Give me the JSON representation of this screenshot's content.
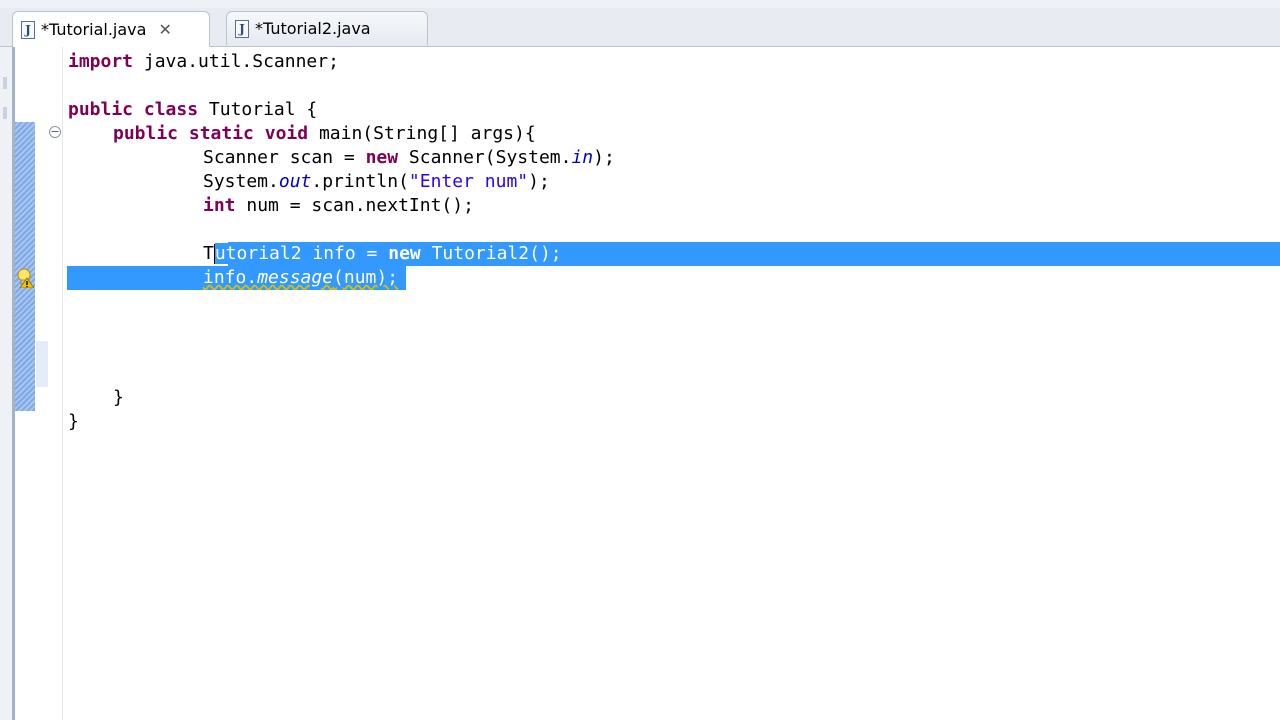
{
  "tabs": [
    {
      "label": "*Tutorial.java",
      "icon": "java-file-icon",
      "active": true
    },
    {
      "label": "*Tutorial2.java",
      "icon": "java-file-icon",
      "active": false
    }
  ],
  "code": {
    "import_kw": "import",
    "import_rest": " java.util.Scanner;",
    "class_kw1": "public",
    "class_kw2": "class",
    "class_name": " Tutorial {",
    "main_kw1": "public",
    "main_kw2": "static",
    "main_kw3": "void",
    "main_sig": " main(String[] args){",
    "scan_decl": "Scanner scan = ",
    "new_kw": "new",
    "scan_ctor": " Scanner(System.",
    "in_field": "in",
    "scan_end": ");",
    "sys_pre": "System.",
    "out_field": "out",
    "println_pre": ".println(",
    "enter_str": "\"Enter num\"",
    "println_end": ");",
    "int_kw": "int",
    "num_decl": " num = scan.nextInt();",
    "t2_first": "T",
    "t2_rest_a": "utorial2 info = ",
    "new_kw2": "new",
    "t2_rest_b": " Tutorial2();",
    "info_pre": "info.",
    "message_call": "message",
    "info_end": "(num);",
    "close_inner": "}",
    "close_outer": "}"
  },
  "colors": {
    "keyword": "#7f0055",
    "string": "#2a00ff",
    "field": "#0000c0",
    "selection": "#3399ff"
  }
}
